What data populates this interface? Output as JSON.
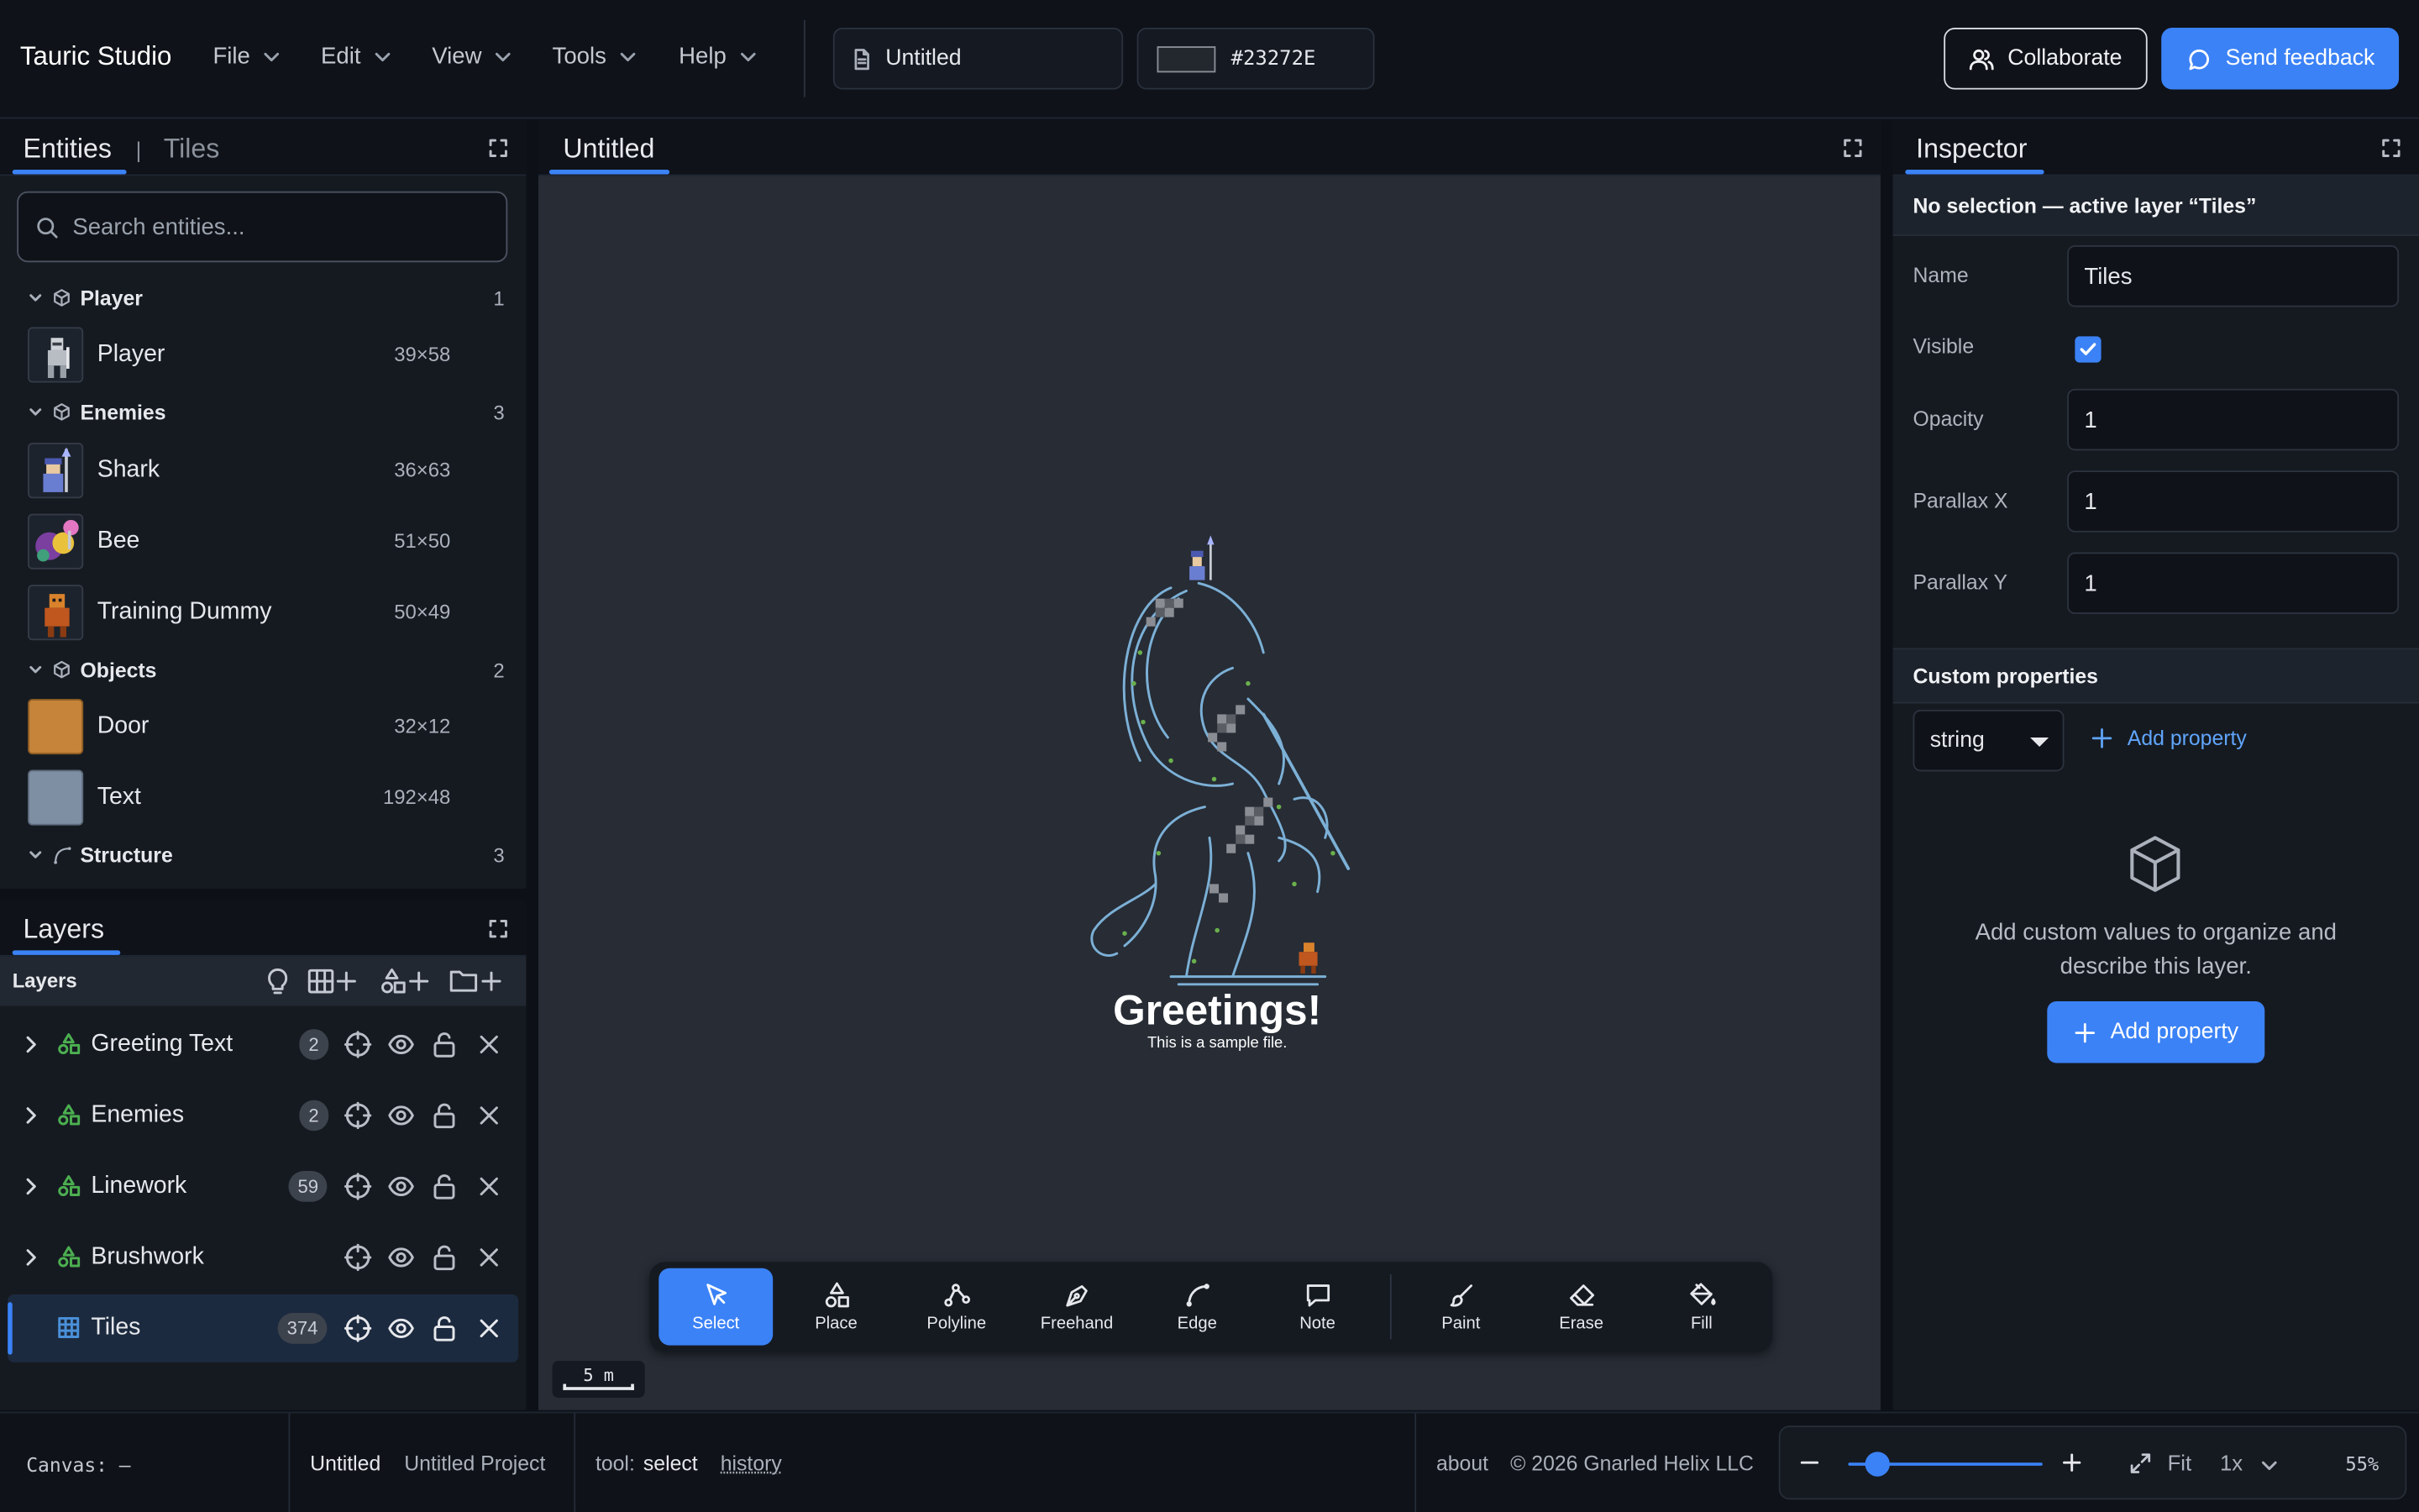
{
  "app": {
    "name": "Tauric Studio"
  },
  "menu": [
    "File",
    "Edit",
    "View",
    "Tools",
    "Help"
  ],
  "document": {
    "name": "Untitled"
  },
  "color": {
    "hex": "#23272E",
    "swatch": "#23272e"
  },
  "header": {
    "collaborate_label": "Collaborate",
    "feedback_label": "Send feedback"
  },
  "entities_panel": {
    "tab_entities": "Entities",
    "tab_separator": "|",
    "tab_tiles": "Tiles",
    "search_placeholder": "Search entities...",
    "groups": [
      {
        "name": "Player",
        "count": "1",
        "items": [
          {
            "name": "Player",
            "size": "39×58"
          }
        ]
      },
      {
        "name": "Enemies",
        "count": "3",
        "items": [
          {
            "name": "Shark",
            "size": "36×63"
          },
          {
            "name": "Bee",
            "size": "51×50"
          },
          {
            "name": "Training Dummy",
            "size": "50×49"
          }
        ]
      },
      {
        "name": "Objects",
        "count": "2",
        "items": [
          {
            "name": "Door",
            "size": "32×12"
          },
          {
            "name": "Text",
            "size": "192×48"
          }
        ]
      },
      {
        "name": "Structure",
        "count": "3",
        "items": []
      }
    ]
  },
  "layers_panel": {
    "title": "Layers",
    "toolbar_label": "Layers",
    "layers": [
      {
        "name": "Greeting Text",
        "count": "2",
        "type": "object-layer-icon"
      },
      {
        "name": "Enemies",
        "count": "2",
        "type": "object-layer-icon"
      },
      {
        "name": "Linework",
        "count": "59",
        "type": "object-layer-icon"
      },
      {
        "name": "Brushwork",
        "count": "",
        "type": "object-layer-icon"
      },
      {
        "name": "Tiles",
        "count": "374",
        "type": "tile-layer-icon",
        "active": true
      }
    ]
  },
  "canvas": {
    "tab": "Untitled",
    "greeting_title": "Greetings!",
    "greeting_sub": "This is a sample file.",
    "scale_label": "5 m",
    "tools": [
      "Select",
      "Place",
      "Polyline",
      "Freehand",
      "Edge",
      "Note",
      "Paint",
      "Erase",
      "Fill"
    ],
    "active_tool": "Select"
  },
  "inspector": {
    "title": "Inspector",
    "selection": "No selection — active layer “Tiles”",
    "name_label": "Name",
    "name_value": "Tiles",
    "visible_label": "Visible",
    "opacity_label": "Opacity",
    "opacity_value": "1",
    "parallax_x_label": "Parallax X",
    "parallax_x_value": "1",
    "parallax_y_label": "Parallax Y",
    "parallax_y_value": "1",
    "custom_title": "Custom properties",
    "type_value": "string",
    "add_property_link": "Add property",
    "empty_text": "Add custom values to organize and describe this layer.",
    "add_property_button": "Add property"
  },
  "status": {
    "canvas": "Canvas: —",
    "doc": "Untitled",
    "project": "Untitled Project",
    "tool_label": "tool:",
    "tool_value": "select",
    "history": "history",
    "about": "about",
    "copyright": "© 2026 Gnarled Helix LLC",
    "fit": "Fit",
    "multiplier": "1x",
    "zoom": "55%",
    "zoom_level": 0.55
  },
  "colors": {
    "accent": "#3b82f6",
    "layer_icon": "#4caf50",
    "tile_icon": "#4a90d9"
  }
}
